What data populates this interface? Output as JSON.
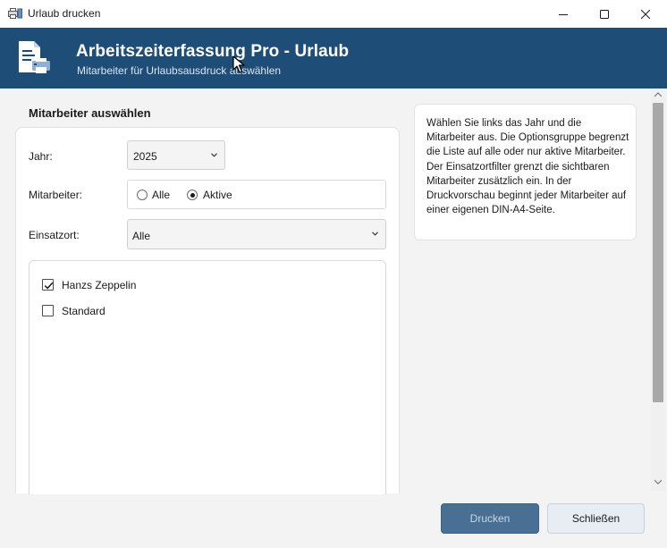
{
  "window": {
    "title": "Urlaub drucken",
    "controls": {
      "minimize_icon": "minimize-icon",
      "maximize_icon": "maximize-icon",
      "close_icon": "close-icon"
    }
  },
  "banner": {
    "title": "Arbeitszeiterfassung Pro - Urlaub",
    "subtitle": "Mitarbeiter für Urlaubsausdruck auswählen",
    "icon": "print-document-icon",
    "background": "#1e4d78"
  },
  "section": {
    "title": "Mitarbeiter auswählen"
  },
  "form": {
    "year": {
      "label": "Jahr:",
      "value": "2025"
    },
    "employees": {
      "label": "Mitarbeiter:",
      "options": [
        {
          "label": "Alle",
          "checked": false
        },
        {
          "label": "Aktive",
          "checked": true
        }
      ]
    },
    "location": {
      "label": "Einsatzort:",
      "value": "Alle"
    },
    "employee_list": [
      {
        "label": "Hanzs Zeppelin",
        "checked": true
      },
      {
        "label": "Standard",
        "checked": false
      }
    ]
  },
  "info": {
    "text": "Wählen Sie links das Jahr und die Mitarbeiter aus. Die Optionsgruppe begrenzt die Liste auf alle oder nur aktive Mitarbeiter. Der Einsatzortfilter grenzt die sichtbaren Mitarbeiter zusätzlich ein. In der Druckvorschau beginnt jeder Mitarbeiter auf einer eigenen DIN-A4-Seite."
  },
  "actions": {
    "print_label": "Drucken",
    "close_label": "Schließen"
  },
  "colors": {
    "accent": "#1e4d78",
    "print_button": "#4a6f95",
    "close_button": "#e8edf3"
  }
}
